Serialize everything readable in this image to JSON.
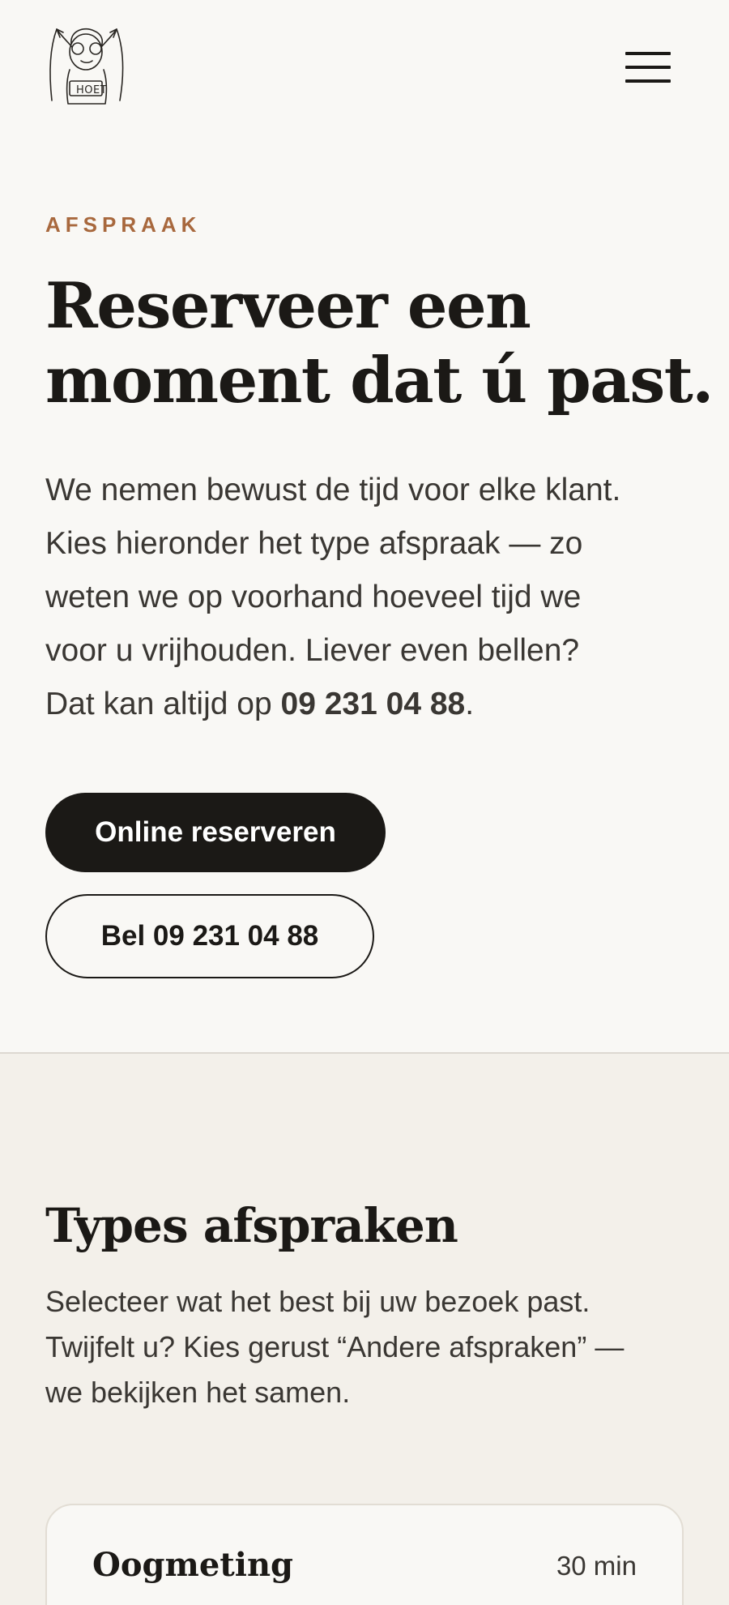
{
  "header": {
    "logo_text": "HOET",
    "menu_icon": "hamburger-menu-icon"
  },
  "hero": {
    "eyebrow": "AFSPRAAK",
    "title_line1": "Reserveer een",
    "title_line2": "moment dat ú past.",
    "text_line1": "We nemen bewust de tijd voor elke klant.",
    "text_line2": "Kies hieronder het type afspraak — zo",
    "text_line3": "weten we op voorhand hoeveel tijd we",
    "text_line4": "voor u vrijhouden. Liever even bellen?",
    "text_line5_prefix": "Dat kan altijd op ",
    "phone": "09 231 04 88",
    "text_line5_suffix": ".",
    "primary_button": "Online reserveren",
    "secondary_button": "Bel 09 231 04 88"
  },
  "types": {
    "title": "Types afspraken",
    "text_line1": "Selecteer wat het best bij uw bezoek past.",
    "text_line2": "Twijfelt u? Kies gerust “Andere afspraken” —",
    "text_line3": "we bekijken het samen.",
    "cards": [
      {
        "title": "Oogmeting",
        "duration": "30 min"
      }
    ]
  },
  "colors": {
    "background": "#f9f8f5",
    "section_background": "#f3f0ea",
    "accent": "#a8683d",
    "ink": "#1b1916"
  }
}
